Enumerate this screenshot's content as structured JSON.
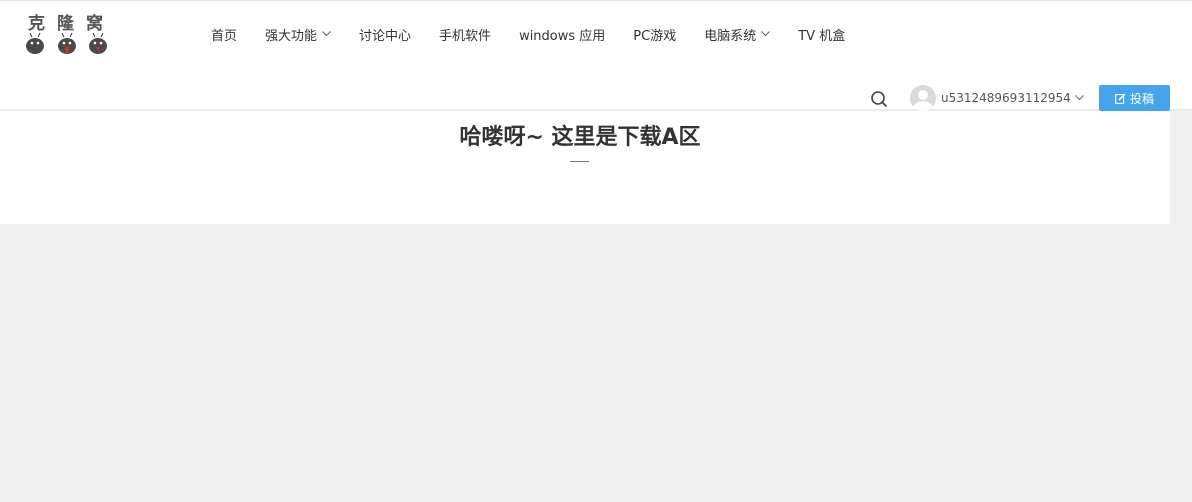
{
  "logo": {
    "text": "克隆窝",
    "bugs": [
      {
        "color": "#4a4a4a",
        "accent": "#333333"
      },
      {
        "color": "#4a4a4a",
        "accent": "#c0392b"
      },
      {
        "color": "#4a4a4a",
        "accent": "#c0392b"
      }
    ]
  },
  "nav": {
    "items": [
      {
        "label": "首页",
        "dropdown": false
      },
      {
        "label": "强大功能",
        "dropdown": true
      },
      {
        "label": "讨论中心",
        "dropdown": false
      },
      {
        "label": "手机软件",
        "dropdown": false
      },
      {
        "label": "windows 应用",
        "dropdown": false
      },
      {
        "label": "PC游戏",
        "dropdown": false
      },
      {
        "label": "电脑系统",
        "dropdown": true
      },
      {
        "label": "TV 机盒",
        "dropdown": false
      }
    ]
  },
  "header": {
    "search_icon": "search-icon",
    "username": "u5312489693112954",
    "post_button_label": "投稿",
    "post_button_icon": "edit-icon"
  },
  "banner": {
    "title": "哈喽呀~ 这里是下载A区"
  },
  "colors": {
    "accent": "#45a4ec",
    "page_background": "#efefef",
    "header_background": "#ffffff"
  }
}
